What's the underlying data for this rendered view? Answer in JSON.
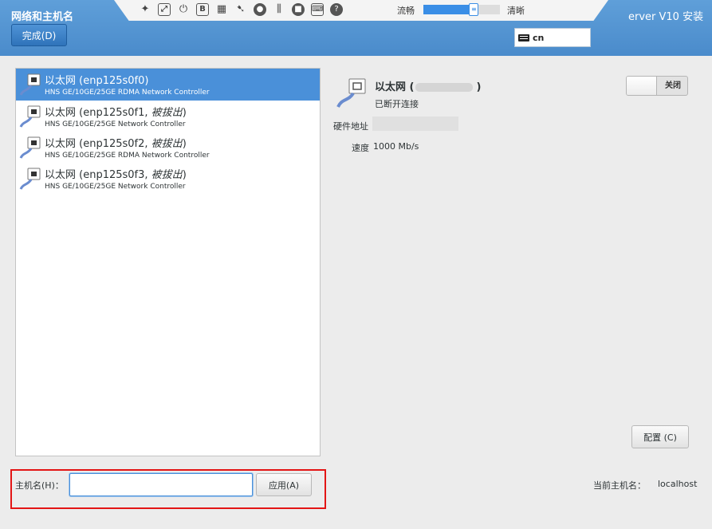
{
  "header": {
    "title": "网络和主机名",
    "done_label": "完成(D)",
    "right_title": "erver V10 安装",
    "keyboard_layout": "cn"
  },
  "toolbar": {
    "icons": [
      "pin-icon",
      "fullscreen-icon",
      "power-icon",
      "bold-b-icon",
      "usb-disk-icon",
      "pointer-icon",
      "disc-icon",
      "usb-icon",
      "camera-icon",
      "keyboard-icon",
      "help-icon"
    ],
    "quality_low": "流畅",
    "quality_high": "清晰",
    "quality_level": 0.66,
    "slider_thumb_glyph": "≡"
  },
  "devices": [
    {
      "name": "以太网 (enp125s0f0)",
      "suffix": "",
      "close": "",
      "desc": "HNS GE/10GE/25GE RDMA Network Controller",
      "selected": true
    },
    {
      "name": "以太网 (enp125s0f1, ",
      "suffix": "被拔出",
      "close": ")",
      "desc": "HNS GE/10GE/25GE Network Controller",
      "selected": false
    },
    {
      "name": "以太网 (enp125s0f2, ",
      "suffix": "被拔出",
      "close": ")",
      "desc": "HNS GE/10GE/25GE RDMA Network Controller",
      "selected": false
    },
    {
      "name": "以太网 (enp125s0f3, ",
      "suffix": "被拔出",
      "close": ")",
      "desc": "HNS GE/10GE/25GE Network Controller",
      "selected": false
    }
  ],
  "detail": {
    "name_prefix": "以太网 (",
    "name_suffix": ")",
    "status": "已断开连接",
    "hw_label": "硬件地址",
    "speed_label": "速度",
    "speed_value": "1000 Mb/s",
    "toggle_label": "关闭",
    "config_label": "配置 (C)"
  },
  "hostname": {
    "label": "主机名(H)：",
    "value": "",
    "apply_label": "应用(A)",
    "current_label": "当前主机名：",
    "current_value": "localhost"
  },
  "colors": {
    "header_blue": "#4a8bcb",
    "selection_blue": "#4a90d9",
    "highlight_red": "#e31515"
  }
}
